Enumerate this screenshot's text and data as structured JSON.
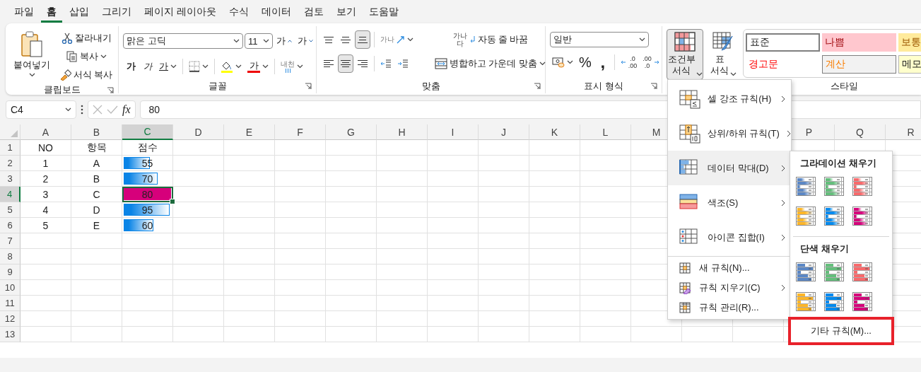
{
  "menu_tabs": [
    {
      "label": "파일",
      "selected": false
    },
    {
      "label": "홈",
      "selected": true
    },
    {
      "label": "삽입",
      "selected": false
    },
    {
      "label": "그리기",
      "selected": false
    },
    {
      "label": "페이지 레이아웃",
      "selected": false
    },
    {
      "label": "수식",
      "selected": false
    },
    {
      "label": "데이터",
      "selected": false
    },
    {
      "label": "검토",
      "selected": false
    },
    {
      "label": "보기",
      "selected": false
    },
    {
      "label": "도움말",
      "selected": false
    }
  ],
  "ribbon": {
    "clipboard": {
      "label": "클립보드",
      "paste": "붙여넣기",
      "cut": "잘라내기",
      "copy": "복사",
      "format_painter": "서식 복사"
    },
    "font": {
      "label": "글꼴",
      "font_name": "맑은 고딕",
      "font_size": "11",
      "grow": "가",
      "shrink": "가",
      "bold": "가",
      "italic": "가",
      "underline": "가",
      "font_color": "가",
      "phonetic": "내천"
    },
    "alignment": {
      "label": "맞춤",
      "vertical_align": [
        {
          "kind": "top",
          "selected": false
        },
        {
          "kind": "middle",
          "selected": false
        },
        {
          "kind": "bottom",
          "selected": true
        }
      ],
      "horizontal_align": [
        {
          "kind": "left",
          "selected": false
        },
        {
          "kind": "center",
          "selected": true
        },
        {
          "kind": "right",
          "selected": false
        }
      ],
      "orientation_text": "가나",
      "wrap_icon_text": "가나다",
      "wrap_text": "자동 줄 바꿈",
      "merge": "병합하고 가운데 맞춤"
    },
    "number": {
      "label": "표시 형식",
      "format": "일반",
      "percent": "%",
      "comma": ",",
      "decrease_decimal": {
        "top": ".0",
        "bottom": ".00"
      },
      "increase_decimal": {
        "top": ".00",
        "bottom": ".0"
      }
    },
    "styles": {
      "label": "스타일",
      "conditional": "조건부 서식",
      "conditional_pressed": true,
      "table": "표 서식",
      "cells": [
        {
          "text": "표준",
          "kind": "normal"
        },
        {
          "text": "나쁨",
          "kind": "bad"
        },
        {
          "text": "보통",
          "kind": "neutral"
        },
        {
          "text": "경고문",
          "kind": "warning"
        },
        {
          "text": "계산",
          "kind": "calculation"
        },
        {
          "text": "메모",
          "kind": "note"
        }
      ]
    }
  },
  "formula_bar": {
    "name_box": "C4",
    "fx": "fx",
    "formula": "80"
  },
  "sheet": {
    "columns": [
      {
        "label": "A",
        "selected": false
      },
      {
        "label": "B",
        "selected": false
      },
      {
        "label": "C",
        "selected": true
      },
      {
        "label": "D",
        "selected": false
      },
      {
        "label": "E",
        "selected": false
      },
      {
        "label": "F",
        "selected": false
      },
      {
        "label": "G",
        "selected": false
      },
      {
        "label": "H",
        "selected": false
      },
      {
        "label": "I",
        "selected": false
      },
      {
        "label": "J",
        "selected": false
      },
      {
        "label": "K",
        "selected": false
      },
      {
        "label": "L",
        "selected": false
      },
      {
        "label": "M",
        "selected": false
      }
    ],
    "columns_right": [
      {
        "label": "P",
        "selected": false
      },
      {
        "label": "Q",
        "selected": false
      },
      {
        "label": "R",
        "selected": false
      }
    ],
    "rows": [
      {
        "label": "1",
        "selected": false,
        "cells": [
          {
            "text": "NO"
          },
          {
            "text": "항목"
          },
          {
            "text": "점수"
          }
        ]
      },
      {
        "label": "2",
        "selected": false,
        "cells": [
          {
            "text": "1"
          },
          {
            "text": "A"
          },
          {
            "text": "55",
            "bar": {
              "kind": "gradient",
              "level": 0.55,
              "color": "#0a84e6"
            }
          }
        ]
      },
      {
        "label": "3",
        "selected": false,
        "cells": [
          {
            "text": "2"
          },
          {
            "text": "B"
          },
          {
            "text": "70",
            "bar": {
              "kind": "gradient",
              "level": 0.71,
              "color": "#0a84e6"
            }
          }
        ]
      },
      {
        "label": "4",
        "selected": true,
        "cells": [
          {
            "text": "3"
          },
          {
            "text": "C"
          },
          {
            "text": "80",
            "active": true,
            "bar": {
              "kind": "solid",
              "level": 1,
              "color": "#d6007b"
            }
          }
        ]
      },
      {
        "label": "5",
        "selected": false,
        "cells": [
          {
            "text": "4"
          },
          {
            "text": "D"
          },
          {
            "text": "95",
            "bar": {
              "kind": "gradient",
              "level": 0.97,
              "color": "#0a84e6"
            }
          }
        ]
      },
      {
        "label": "6",
        "selected": false,
        "cells": [
          {
            "text": "5"
          },
          {
            "text": "E"
          },
          {
            "text": "60",
            "bar": {
              "kind": "gradient",
              "level": 0.62,
              "color": "#0a84e6"
            }
          }
        ]
      },
      {
        "label": "7",
        "selected": false,
        "cells": []
      },
      {
        "label": "8",
        "selected": false,
        "cells": []
      },
      {
        "label": "9",
        "selected": false,
        "cells": []
      },
      {
        "label": "10",
        "selected": false,
        "cells": []
      },
      {
        "label": "11",
        "selected": false,
        "cells": []
      },
      {
        "label": "12",
        "selected": false,
        "cells": []
      },
      {
        "label": "13",
        "selected": false,
        "cells": []
      }
    ]
  },
  "cf_menu": {
    "items": [
      {
        "kind": "highlight",
        "label": "셀 강조 규칙(H)",
        "submenu": true,
        "selected": false
      },
      {
        "kind": "topbottom",
        "label": "상위/하위 규칙(T)",
        "submenu": true,
        "selected": false
      },
      {
        "kind": "databar",
        "label": "데이터 막대(D)",
        "submenu": true,
        "selected": true
      },
      {
        "kind": "colorscale",
        "label": "색조(S)",
        "submenu": true,
        "selected": false
      },
      {
        "kind": "iconset",
        "label": "아이콘 집합(I)",
        "submenu": true,
        "selected": false
      },
      {
        "kind": "new",
        "label": "새 규칙(N)...",
        "submenu": false,
        "selected": false
      },
      {
        "kind": "clear",
        "label": "규칙 지우기(C)",
        "submenu": true,
        "selected": false
      },
      {
        "kind": "manage",
        "label": "규칙 관리(R)...",
        "submenu": false,
        "selected": false
      }
    ]
  },
  "databar_submenu": {
    "sections": [
      {
        "title": "그라데이션 채우기",
        "swatches": [
          {
            "kind": "gradient",
            "color": "#5b87c5"
          },
          {
            "kind": "gradient",
            "color": "#63be7b"
          },
          {
            "kind": "gradient",
            "color": "#f8696b"
          },
          {
            "kind": "gradient",
            "color": "#ffb628"
          },
          {
            "kind": "gradient",
            "color": "#008aef"
          },
          {
            "kind": "gradient",
            "color": "#d6007b"
          }
        ]
      },
      {
        "title": "단색 채우기",
        "swatches": [
          {
            "kind": "solid",
            "color": "#5b87c5"
          },
          {
            "kind": "solid",
            "color": "#63be7b"
          },
          {
            "kind": "solid",
            "color": "#f8696b"
          },
          {
            "kind": "solid",
            "color": "#ffb628"
          },
          {
            "kind": "solid",
            "color": "#008aef"
          },
          {
            "kind": "solid",
            "color": "#d6007b"
          }
        ]
      }
    ],
    "more_rules": {
      "label": "기타 규칙(M)...",
      "highlighted": true
    }
  }
}
